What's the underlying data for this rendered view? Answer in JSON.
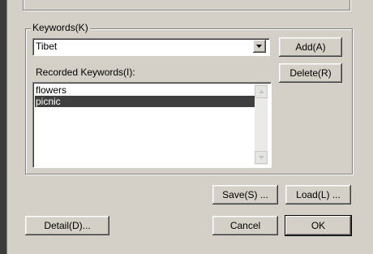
{
  "keywords_group": {
    "label": "Keywords(K)",
    "combo_value": "Tibet",
    "recorded_label": "Recorded Keywords(I):",
    "recorded_items": [
      "flowers",
      "picnic"
    ],
    "selected_index": 1
  },
  "buttons": {
    "add": "Add(A)",
    "delete": "Delete(R)",
    "save": "Save(S) ...",
    "load": "Load(L) ...",
    "detail": "Detail(D)...",
    "cancel": "Cancel",
    "ok": "OK"
  },
  "icons": {
    "dropdown": "chevron-down-icon",
    "scroll_up": "scroll-up-arrow-icon",
    "scroll_down": "scroll-down-arrow-icon"
  },
  "colors": {
    "selection": "#3f3f3f",
    "dialog_bg": "#d4d0c8"
  }
}
